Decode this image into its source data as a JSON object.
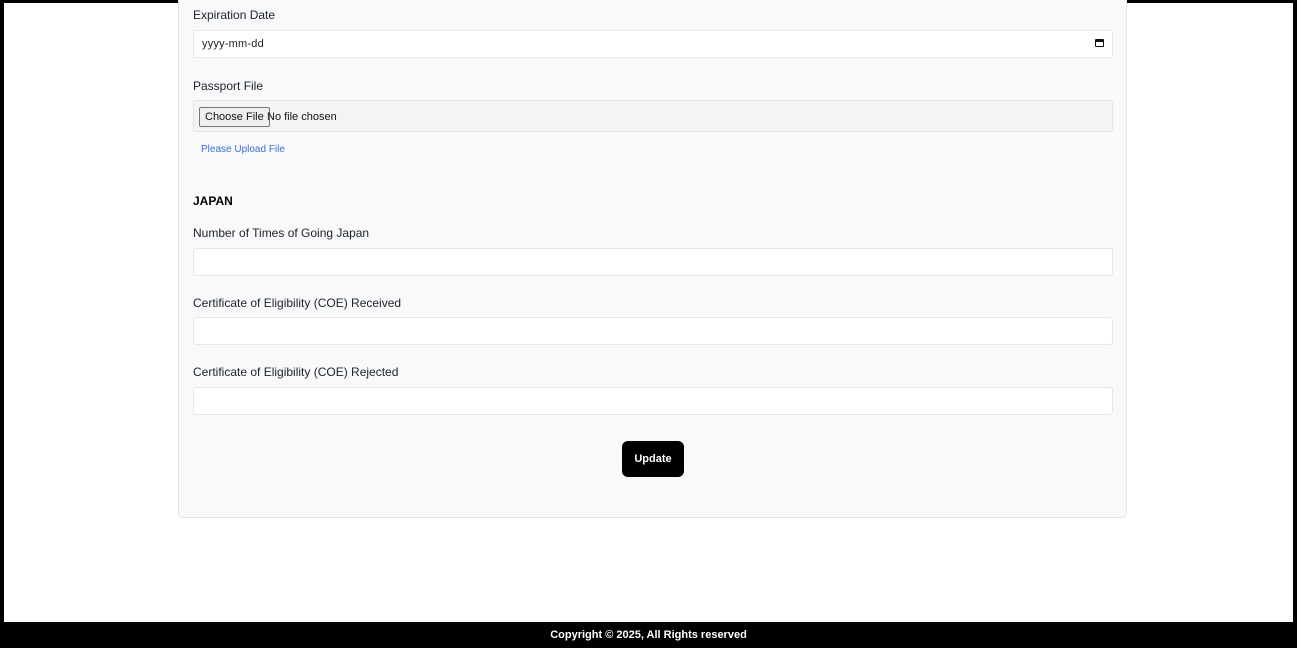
{
  "passport": {
    "expiration_label": "Expiration Date",
    "expiration_value": "yyyy-mm-dd",
    "file_label": "Passport File",
    "choose_file_label": "Choose File",
    "file_status": "No file chosen",
    "upload_hint": "Please Upload File"
  },
  "japan": {
    "section_title": "JAPAN",
    "times_label": "Number of Times of Going Japan",
    "times_value": "",
    "coe_received_label": "Certificate of Eligibility (COE) Received",
    "coe_received_value": "",
    "coe_rejected_label": "Certificate of Eligibility (COE) Rejected",
    "coe_rejected_value": ""
  },
  "actions": {
    "update_label": "Update"
  },
  "footer": {
    "copyright": "Copyright © 2025, All Rights reserved"
  },
  "icons": {
    "date_picker": "calendar-icon"
  },
  "colors": {
    "card_background": "#f8f9fa",
    "link": "#3b6fd8",
    "button": "#000000",
    "footer": "#000000"
  }
}
